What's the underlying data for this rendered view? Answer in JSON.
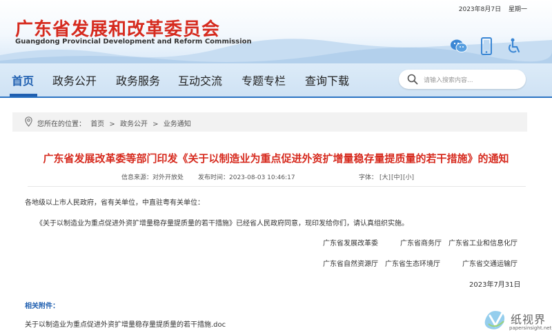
{
  "header": {
    "date": "2023年8月7日",
    "weekday": "星期一",
    "org_name_cn": "广东省发展和改革委员会",
    "org_name_en": "Guangdong Provincial Development and Reform Commission",
    "icons": [
      "wechat-icon",
      "mobile-icon",
      "accessibility-icon"
    ]
  },
  "nav": {
    "items": [
      {
        "label": "首页"
      },
      {
        "label": "政务公开"
      },
      {
        "label": "政务服务"
      },
      {
        "label": "互动交流"
      },
      {
        "label": "专题专栏"
      },
      {
        "label": "查询下载"
      }
    ],
    "search_placeholder": "请输入搜索内容..."
  },
  "breadcrumb": {
    "prefix": "您所在的位置：",
    "items": [
      "首页",
      "政务公开",
      "业务通知"
    ],
    "sep": ">"
  },
  "article": {
    "title": "广东省发展改革委等部门印发《关于以制造业为重点促进外资扩增量稳存量提质量的若干措施》的通知",
    "source": "信息来源：对外开放处",
    "time": "发布时间：2023-08-03 10:46:17",
    "font_label": "字体：",
    "font_large": "[大]",
    "font_medium": "[中]",
    "font_small": "[小]",
    "salutation": "各地级以上市人民政府，省有关单位，中直驻粤有关单位：",
    "body": "《关于以制造业为重点促进外资扩增量稳存量提质量的若干措施》已经省人民政府同意，现印发给你们，请认真组织实施。",
    "signatories_row1": [
      "广东省发展改革委",
      "广东省商务厅",
      "广东省工业和信息化厅"
    ],
    "signatories_row2": [
      "广东省自然资源厅",
      "广东省生态环境厅",
      "广东省交通运输厅"
    ],
    "date": "2023年7月31日",
    "attachments_label": "相关附件：",
    "attachment": "关于以制造业为重点促进外资扩增量稳存量提质量的若干措施.doc"
  },
  "watermark": {
    "cn": "纸视界",
    "en": "papersinsight.net"
  },
  "colors": {
    "brand_red": "#d62a1e",
    "brand_blue": "#1f5fb0"
  }
}
